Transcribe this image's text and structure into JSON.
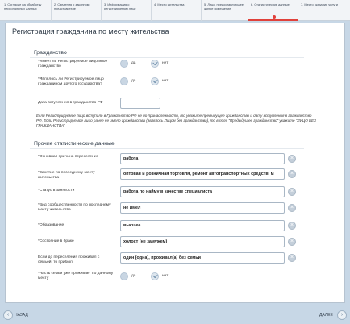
{
  "steps": [
    {
      "label": "1. Согласие на обработку персональных данных"
    },
    {
      "label": "2. Сведения о законном представителе"
    },
    {
      "label": "3. Информация о регистрируемом лице"
    },
    {
      "label": "4. Место жительства"
    },
    {
      "label": "5. Лицо, предоставляющее жилое помещение"
    },
    {
      "label": "6. Статистические данные"
    },
    {
      "label": "7. Место оказания услуги"
    }
  ],
  "page_title": "Регистрация гражданина по месту жительства",
  "citizenship": {
    "title": "Гражданство",
    "q1": "*Имеет ли Регистрируемое лицо иное гражданство",
    "q2": "*Являлось ли Регистрируемое лицо гражданином другого государства?",
    "date_label": "Дата вступления в гражданство РФ",
    "date_value": "",
    "yes": "да",
    "no": "нет",
    "note": "Если Регистрируемое лицо вступало в Гражданство РФ не по принадлежности, то укажите предыдущее гражданство и дату вступления в гражданство РФ. Если Регистрируемое лицо ранее не имело гражданства (являлось Лицом без гражданства), то в поле \"Предыдущее гражданство\" укажите \"ЛИЦО БЕЗ ГРАЖДАНСТВА\""
  },
  "stats": {
    "title": "Прочие статистические данные",
    "fields": [
      {
        "label": "*Основная причина переселения",
        "value": "работа"
      },
      {
        "label": "*Занятие по последнему месту жительства",
        "value": "оптовая и розничная торговля, ремонт автотранспортных средств, м"
      },
      {
        "label": "*Статус в занятости",
        "value": "работа по найму в качестве специалиста"
      },
      {
        "label": "*Вид сообщественности по последнему месту жительства",
        "value": "не имел"
      },
      {
        "label": "*Образование",
        "value": "высшее"
      },
      {
        "label": "*Состояние в браке",
        "value": "холост (не замужем)"
      },
      {
        "label": "Если до переселения проживал с семьей, то прибыл",
        "value": "один (одна), проживал(а) без семьи"
      }
    ],
    "family_q": "*Часть семьи уже проживает по данному месту"
  },
  "nav": {
    "back": "НАЗАД",
    "next": "ДАЛЕЕ"
  }
}
